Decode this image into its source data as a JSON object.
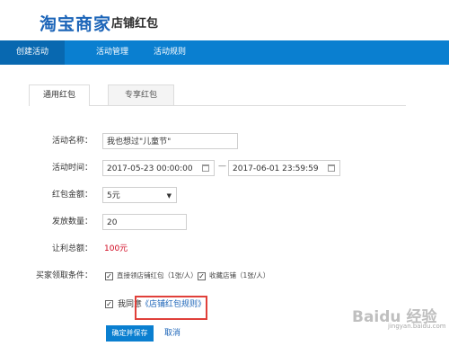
{
  "header": {
    "logo": "淘宝商家",
    "subtitle": "店铺红包"
  },
  "nav": {
    "items": [
      {
        "label": "创建活动"
      },
      {
        "label": "活动管理"
      },
      {
        "label": "活动规则"
      }
    ],
    "active_index": 0
  },
  "tabs": [
    {
      "label": "通用红包"
    },
    {
      "label": "专享红包"
    }
  ],
  "form": {
    "name_label": "活动名称：",
    "name_value": "我也想过\"儿童节\"",
    "time_label": "活动时间：",
    "start_time": "2017-05-23 00:00:00",
    "end_time": "2017-06-01 23:59:59",
    "time_sep": "—",
    "amount_label": "红包金额：",
    "amount_value": "5元",
    "count_label": "发放数量：",
    "count_value": "20",
    "total_label": "让利总额：",
    "total_value": "100元",
    "condition_label": "买家领取条件：",
    "condition_1": "直接领店铺红包（1张/人）",
    "condition_2": "收藏店铺（1张/人）",
    "agree_text": "我同意",
    "rule_link": "《店铺红包规则》"
  },
  "buttons": {
    "save": "确定并保存",
    "cancel": "取消"
  },
  "watermark": {
    "main": "Baidu 经验",
    "sub": "jingyan.baidu.com"
  }
}
